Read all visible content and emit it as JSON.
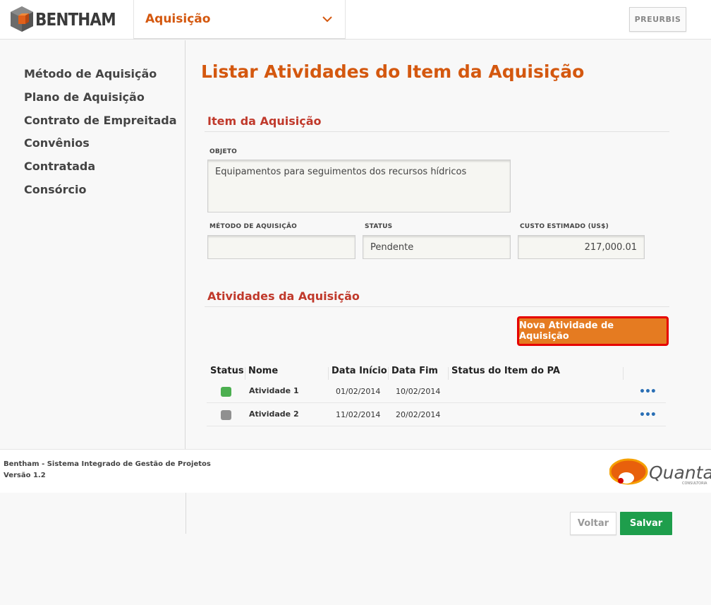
{
  "header": {
    "brand": "BENTHAM",
    "module": "Aquisição",
    "preurbis_label": "PREURBIS"
  },
  "sidebar": {
    "items": [
      {
        "label": "Método de Aquisição"
      },
      {
        "label": "Plano de Aquisição"
      },
      {
        "label": "Contrato de Empreitada"
      },
      {
        "label": "Convênios"
      },
      {
        "label": "Contratada"
      },
      {
        "label": "Consórcio"
      }
    ]
  },
  "main": {
    "title": "Listar Atividades do Item da Aquisição",
    "item_section": {
      "title": "Item da Aquisição",
      "objeto_label": "OBJETO",
      "objeto_value": "Equipamentos para seguimentos dos recursos hídricos",
      "metodo_label": "MÉTODO DE AQUISIÇÃO",
      "metodo_value": "",
      "status_label": "STATUS",
      "status_value": "Pendente",
      "custo_label": "CUSTO ESTIMADO (US$)",
      "custo_value": "217,000.01"
    },
    "atividades_section": {
      "title": "Atividades da Aquisição",
      "new_button": "Nova Atividade de Aquisição"
    },
    "table": {
      "headers": [
        "Status",
        "Nome",
        "Data Início",
        "Data Fim",
        "Status do Item do PA"
      ],
      "rows": [
        {
          "status_color": "#4caf50",
          "nome": "Atividade 1",
          "inicio": "01/02/2014",
          "fim": "10/02/2014",
          "status_pa": "",
          "actions": "•••"
        },
        {
          "status_color": "#909090",
          "nome": "Atividade 2",
          "inicio": "11/02/2014",
          "fim": "20/02/2014",
          "status_pa": "",
          "actions": "•••"
        }
      ]
    }
  },
  "footer": {
    "system_name": "Bentham - Sistema Integrado de Gestão de Projetos",
    "version": "Versão 1.2",
    "partner_logo": "Quanta",
    "partner_tagline": "CONSULTORIA"
  },
  "actions": {
    "voltar": "Voltar",
    "salvar": "Salvar"
  },
  "colors": {
    "accent": "#d4580f",
    "section": "#c0392b",
    "button_orange": "#e57b21",
    "button_green": "#1e9e4c",
    "link_blue": "#2a6fb5"
  }
}
